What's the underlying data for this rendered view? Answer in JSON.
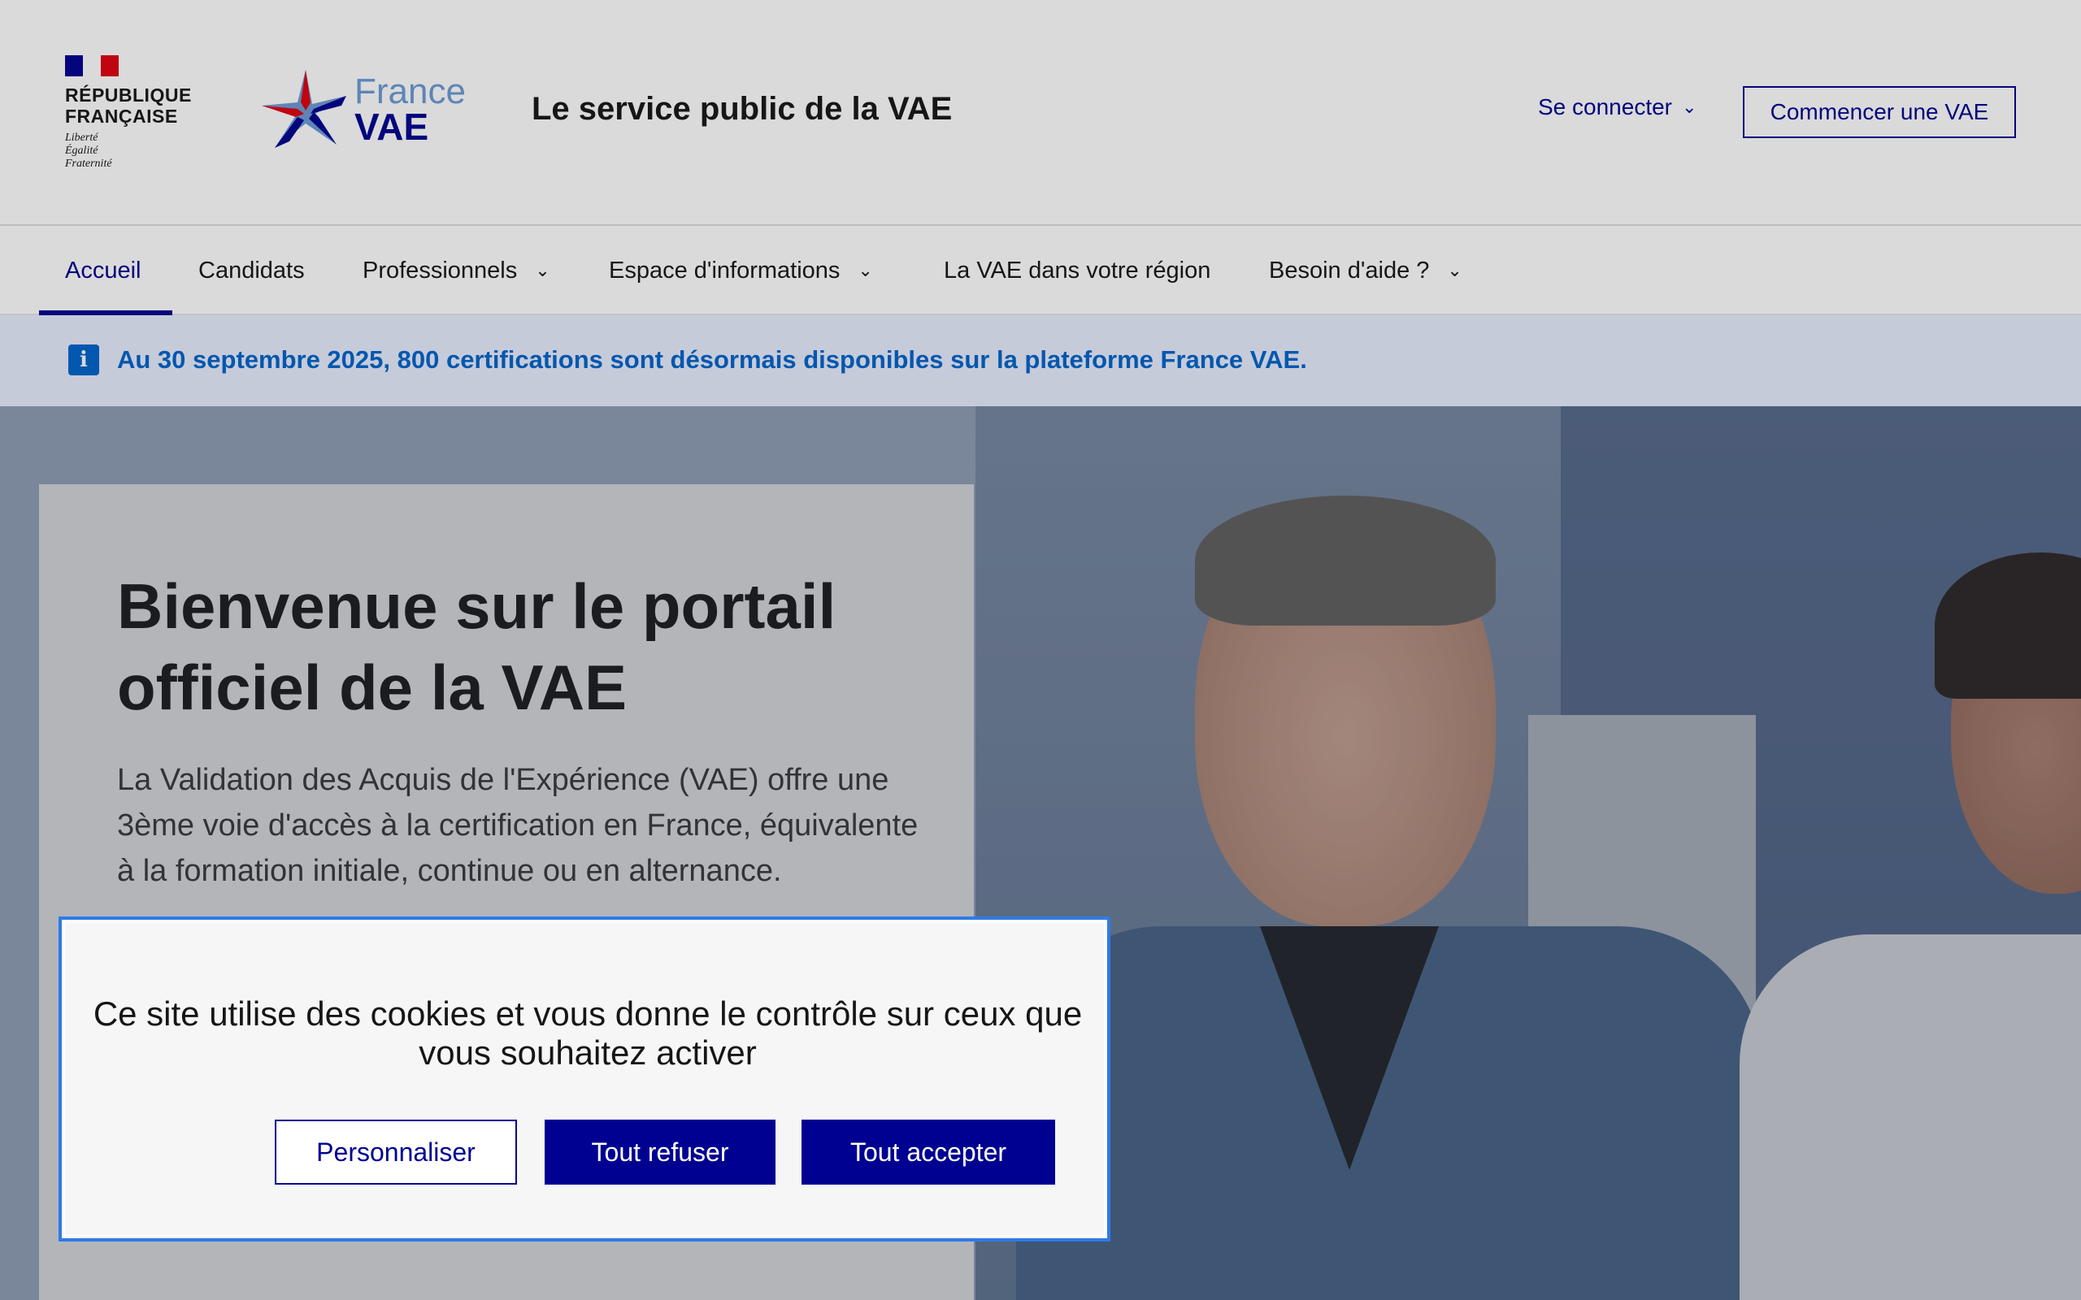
{
  "header": {
    "republic_name_line1": "RÉPUBLIQUE",
    "republic_name_line2": "FRANÇAISE",
    "motto_1": "Liberté",
    "motto_2": "Égalité",
    "motto_3": "Fraternité",
    "brand_line1": "France",
    "brand_line2": "VAE",
    "service_title": "Le service public de la VAE",
    "login_label": "Se connecter",
    "start_button": "Commencer une VAE"
  },
  "nav": {
    "items": [
      {
        "label": "Accueil",
        "active": true
      },
      {
        "label": "Candidats"
      },
      {
        "label": "Professionnels",
        "dropdown": true
      },
      {
        "label": "Espace d'informations",
        "dropdown": true
      },
      {
        "label": "La VAE dans votre région"
      },
      {
        "label": "Besoin d'aide ?",
        "dropdown": true
      }
    ]
  },
  "notice": {
    "icon": "info-icon",
    "text": "Au 30 septembre 2025, 800 certifications sont désormais disponibles sur la plateforme France VAE."
  },
  "hero": {
    "title": "Bienvenue sur le portail officiel de la VAE",
    "description": "La Validation des Acquis de l'Expérience (VAE) offre une 3ème voie d'accès à la certification en France, équivalente à la formation initiale, continue ou en alternance."
  },
  "cookie_banner": {
    "message": "Ce site utilise des cookies et vous donne le contrôle sur ceux que vous souhaitez activer",
    "customize_label": "Personnaliser",
    "refuse_label": "Tout refuser",
    "accept_label": "Tout accepter"
  },
  "colors": {
    "primary": "#000091",
    "info": "#0063cb",
    "focus": "#2f7ae6"
  }
}
